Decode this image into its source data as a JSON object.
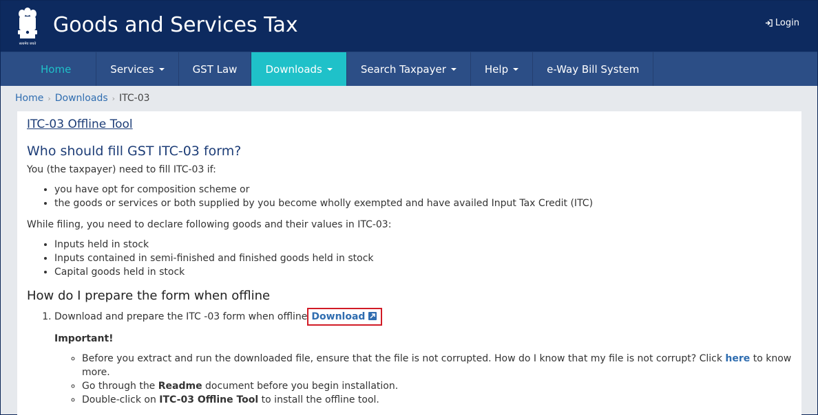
{
  "header": {
    "title": "Goods and Services Tax",
    "login_label": "Login",
    "emblem_icon": "state-emblem-icon",
    "emblem_caption": "सत्यमेव जयते"
  },
  "nav": {
    "items": [
      {
        "label": "Home",
        "dropdown": false,
        "active": false
      },
      {
        "label": "Services",
        "dropdown": true,
        "active": false
      },
      {
        "label": "GST Law",
        "dropdown": false,
        "active": false
      },
      {
        "label": "Downloads",
        "dropdown": true,
        "active": true
      },
      {
        "label": "Search Taxpayer",
        "dropdown": true,
        "active": false
      },
      {
        "label": "Help",
        "dropdown": true,
        "active": false
      },
      {
        "label": "e-Way Bill System",
        "dropdown": false,
        "active": false
      }
    ]
  },
  "breadcrumb": {
    "items": [
      "Home",
      "Downloads",
      "ITC-03"
    ]
  },
  "content": {
    "tool_title": "ITC-03 Offline Tool",
    "who_heading": "Who should fill GST ITC-03 form?",
    "who_intro": "You (the taxpayer) need to fill ITC-03 if:",
    "who_bullets": [
      "you have opt for composition scheme or",
      "the goods or services or both supplied by you become wholly exempted and have availed Input Tax Credit (ITC)"
    ],
    "declare_intro": "While filing, you need to declare following goods and their values in ITC-03:",
    "declare_bullets": [
      "Inputs held in stock",
      "Inputs contained in semi-finished and finished goods held in stock",
      "Capital goods held in stock"
    ],
    "prepare_heading": "How do I prepare the form when offline",
    "step1_text": "Download and prepare the ITC -03 form when offline",
    "download_label": "Download",
    "important_label": "Important!",
    "notes": {
      "note1_text": "Before you extract and run the downloaded file, ensure that the file is not corrupted. How do I know that my file is not corrupt? Click",
      "note1_link": "here",
      "note1_tail": "to know more.",
      "note2_pre": "Go through the",
      "note2_bold": "Readme",
      "note2_post": "document before you begin installation.",
      "note3_pre": "Double-click on",
      "note3_bold": "ITC-03 Offline Tool",
      "note3_post": "to install the offline tool."
    }
  },
  "colors": {
    "header_bg": "#0d2a5f",
    "nav_bg": "#2c4e86",
    "active_tab": "#1fc1c9",
    "link": "#2f6db0",
    "highlight_box": "#d11b26"
  }
}
